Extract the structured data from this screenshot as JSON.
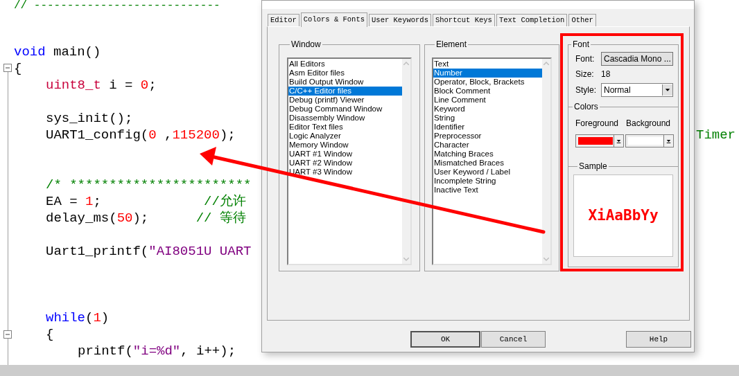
{
  "editor": {
    "lines": [
      {
        "kind": "code",
        "tokens": [
          {
            "kind": "comment",
            "text": "// ----------------------------"
          }
        ]
      },
      {
        "kind": "blank"
      },
      {
        "kind": "blank"
      },
      {
        "kind": "code",
        "tokens": [
          {
            "kind": "keyword",
            "text": "void"
          },
          {
            "kind": "plain",
            "text": " main()"
          }
        ]
      },
      {
        "kind": "code",
        "tokens": [
          {
            "kind": "plain",
            "text": "{"
          }
        ],
        "children": [
          {
            "kind": "code",
            "tokens": [
              {
                "kind": "type",
                "text": "uint8_t"
              },
              {
                "kind": "plain",
                "text": " i = "
              },
              {
                "kind": "number",
                "text": "0"
              },
              {
                "kind": "plain",
                "text": ";"
              }
            ]
          },
          {
            "kind": "blank"
          },
          {
            "kind": "code",
            "tokens": [
              {
                "kind": "plain",
                "text": "sys_init();"
              }
            ]
          },
          {
            "kind": "code",
            "tokens": [
              {
                "kind": "plain",
                "text": "UART1_config("
              },
              {
                "kind": "number",
                "text": "0"
              },
              {
                "kind": "plain",
                "text": " ,"
              },
              {
                "kind": "number",
                "text": "115200"
              },
              {
                "kind": "plain",
                "text": ");"
              }
            ],
            "tail": {
              "kind": "comment",
              "text": "Timer"
            }
          },
          {
            "kind": "blank"
          },
          {
            "kind": "blank"
          },
          {
            "kind": "code",
            "tokens": [
              {
                "kind": "comment",
                "text": "/* ***********************"
              }
            ]
          },
          {
            "kind": "code",
            "tokens": [
              {
                "kind": "plain",
                "text": "EA = "
              },
              {
                "kind": "number",
                "text": "1"
              },
              {
                "kind": "plain",
                "text": ";             "
              },
              {
                "kind": "comment",
                "text": "//允许"
              }
            ]
          },
          {
            "kind": "code",
            "tokens": [
              {
                "kind": "plain",
                "text": "delay_ms("
              },
              {
                "kind": "number",
                "text": "50"
              },
              {
                "kind": "plain",
                "text": ");      "
              },
              {
                "kind": "comment",
                "text": "// 等待"
              }
            ]
          },
          {
            "kind": "blank"
          },
          {
            "kind": "code",
            "tokens": [
              {
                "kind": "plain",
                "text": "Uart1_printf("
              },
              {
                "kind": "string",
                "text": "\"AI8051U UART"
              }
            ]
          },
          {
            "kind": "blank"
          },
          {
            "kind": "blank"
          },
          {
            "kind": "blank"
          },
          {
            "kind": "code",
            "tokens": [
              {
                "kind": "keyword",
                "text": "while"
              },
              {
                "kind": "plain",
                "text": "("
              },
              {
                "kind": "number",
                "text": "1"
              },
              {
                "kind": "plain",
                "text": ")"
              }
            ]
          },
          {
            "kind": "code",
            "tokens": [
              {
                "kind": "plain",
                "text": "{"
              }
            ],
            "children": [
              {
                "kind": "code",
                "tokens": [
                  {
                    "kind": "plain",
                    "text": "printf("
                  },
                  {
                    "kind": "string",
                    "text": "\"i=%d\""
                  },
                  {
                    "kind": "plain",
                    "text": ", i++);"
                  }
                ]
              }
            ]
          }
        ]
      }
    ]
  },
  "dialog": {
    "tabs": [
      {
        "label": "Editor",
        "selected": false
      },
      {
        "label": "Colors & Fonts",
        "selected": true
      },
      {
        "label": "User Keywords",
        "selected": false
      },
      {
        "label": "Shortcut Keys",
        "selected": false
      },
      {
        "label": "Text Completion",
        "selected": false
      },
      {
        "label": "Other",
        "selected": false
      }
    ],
    "window_group": {
      "legend": "Window",
      "items": [
        {
          "label": "All Editors",
          "selected": false
        },
        {
          "label": "Asm Editor files",
          "selected": false
        },
        {
          "label": "Build Output Window",
          "selected": false
        },
        {
          "label": "C/C++ Editor files",
          "selected": true
        },
        {
          "label": "Debug (printf) Viewer",
          "selected": false
        },
        {
          "label": "Debug Command Window",
          "selected": false
        },
        {
          "label": "Disassembly Window",
          "selected": false
        },
        {
          "label": "Editor Text files",
          "selected": false
        },
        {
          "label": "Logic Analyzer",
          "selected": false
        },
        {
          "label": "Memory Window",
          "selected": false
        },
        {
          "label": "UART #1 Window",
          "selected": false
        },
        {
          "label": "UART #2 Window",
          "selected": false
        },
        {
          "label": "UART #3 Window",
          "selected": false
        }
      ]
    },
    "element_group": {
      "legend": "Element",
      "items": [
        {
          "label": "Text",
          "selected": false
        },
        {
          "label": "Number",
          "selected": true
        },
        {
          "label": "Operator, Block, Brackets",
          "selected": false
        },
        {
          "label": "Block Comment",
          "selected": false
        },
        {
          "label": "Line Comment",
          "selected": false
        },
        {
          "label": "Keyword",
          "selected": false
        },
        {
          "label": "String",
          "selected": false
        },
        {
          "label": "Identifier",
          "selected": false
        },
        {
          "label": "Preprocessor",
          "selected": false
        },
        {
          "label": "Character",
          "selected": false
        },
        {
          "label": "Matching Braces",
          "selected": false
        },
        {
          "label": "Mismatched Braces",
          "selected": false
        },
        {
          "label": "User Keyword / Label",
          "selected": false
        },
        {
          "label": "Incomplete String",
          "selected": false
        },
        {
          "label": "Inactive Text",
          "selected": false
        }
      ]
    },
    "font_group": {
      "legend": "Font",
      "font_label": "Font:",
      "font_button": "Cascadia Mono ...",
      "size_label": "Size:",
      "size_value": "18",
      "style_label": "Style:",
      "style_value": "Normal"
    },
    "colors_group": {
      "legend": "Colors",
      "foreground": {
        "label": "Foreground",
        "color": "#ff0000"
      },
      "background": {
        "label": "Background",
        "color": "#ffffff"
      }
    },
    "sample_group": {
      "legend": "Sample",
      "text": "XiAaBbYy"
    },
    "buttons": [
      "OK",
      "Cancel",
      "Help"
    ]
  }
}
